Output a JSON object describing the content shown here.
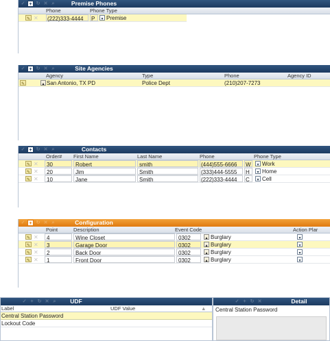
{
  "premise_phones": {
    "title": "Premise Phones",
    "headers": {
      "phone": "Phone",
      "phone_type": "Phone Type"
    },
    "rows": [
      {
        "phone": "(222)333-4444",
        "type_code": "P",
        "type_label": "Premise"
      }
    ]
  },
  "site_agencies": {
    "title": "Site Agencies",
    "headers": {
      "agency": "Agency",
      "type": "Type",
      "phone": "Phone",
      "agency_id": "Agency ID"
    },
    "rows": [
      {
        "agency": "San Antonio, TX PD",
        "type": "Police Dept",
        "phone": "(210)207-7273",
        "agency_id": ""
      }
    ]
  },
  "contacts": {
    "title": "Contacts",
    "headers": {
      "order": "Order#",
      "first_name": "First Name",
      "last_name": "Last Name",
      "phone": "Phone",
      "phone_type": "Phone Type"
    },
    "rows": [
      {
        "order": "30",
        "first": "Robert",
        "last": "smith",
        "phone": "(444)555-6666",
        "code": "W",
        "label": "Work"
      },
      {
        "order": "20",
        "first": "Jim",
        "last": "Smith",
        "phone": "(333)444-5555",
        "code": "H",
        "label": "Home"
      },
      {
        "order": "10",
        "first": "Jane",
        "last": "Smith",
        "phone": "(222)333-4444",
        "code": "C",
        "label": "Cell"
      }
    ]
  },
  "configuration": {
    "title": "Configuration",
    "headers": {
      "point": "Point",
      "description": "Description",
      "event_code": "Event Code",
      "action_plan": "Action Plar"
    },
    "rows": [
      {
        "point": "4",
        "description": "Wine Closet",
        "code": "0302",
        "event": "Burglary"
      },
      {
        "point": "3",
        "description": "Garage Door",
        "code": "0302",
        "event": "Burglary"
      },
      {
        "point": "2",
        "description": "Back Door",
        "code": "0302",
        "event": "Burglary"
      },
      {
        "point": "1",
        "description": "Front Door",
        "code": "0302",
        "event": "Burglary"
      }
    ]
  },
  "udf": {
    "title": "UDF",
    "headers": {
      "label": "Label",
      "value": "UDF Value"
    },
    "rows": [
      {
        "label": "Central Station Password"
      },
      {
        "label": "Lockout Code"
      }
    ]
  },
  "detail": {
    "title": "Detail",
    "field_label": "Central Station Password"
  },
  "colors": {
    "title_blue": "#1c3a60",
    "title_orange": "#e07a10",
    "selected_row": "#fdf8bf"
  }
}
